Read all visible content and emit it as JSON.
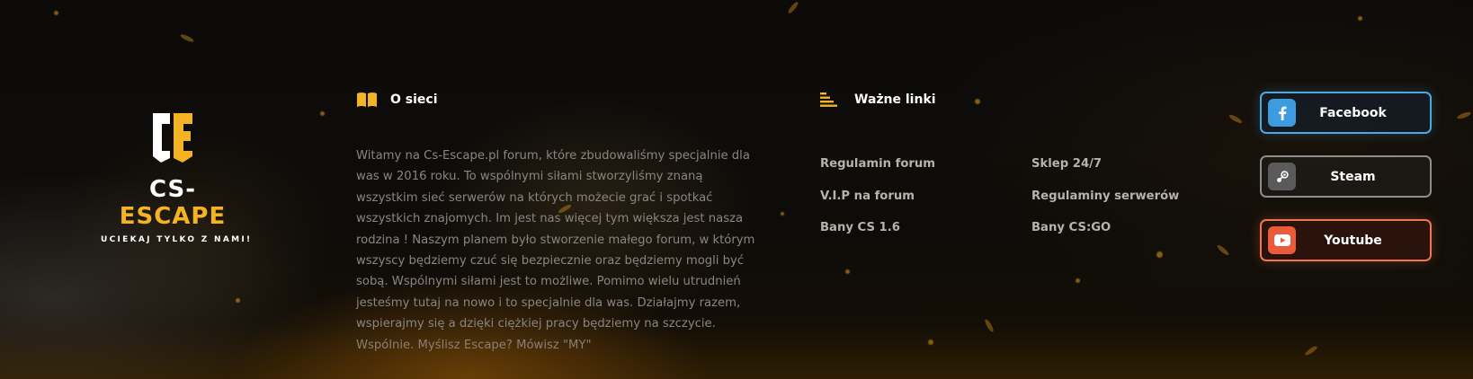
{
  "brand": {
    "logo_letters": "CE",
    "name_part1": "CS-",
    "name_part2": "ESCAPE",
    "tagline": "UCIEKAJ TYLKO Z NAMI!"
  },
  "about": {
    "icon": "book-icon",
    "title": "O sieci",
    "text": "Witamy na Cs-Escape.pl forum, które zbudowaliśmy specjalnie dla was w 2016 roku. To wspólnymi siłami stworzyliśmy znaną wszystkim sieć serwerów na których możecie grać i spotkać wszystkich znajomych. Im jest nas więcej tym większa jest nasza rodzina ! Naszym planem było stworzenie małego forum, w którym wszyscy będziemy czuć się bezpiecznie oraz będziemy mogli być sobą. Wspólnymi siłami jest to możliwe. Pomimo wielu utrudnień jesteśmy tutaj na nowo i to specjalnie dla was. Działajmy razem, wspierajmy się a dzięki ciężkiej pracy będziemy na szczycie. Wspólnie. Myślisz Escape? Mówisz \"MY\""
  },
  "links": {
    "icon": "list-icon",
    "title": "Ważne linki",
    "items": [
      {
        "label": "Regulamin forum"
      },
      {
        "label": "Sklep 24/7"
      },
      {
        "label": "V.I.P na forum"
      },
      {
        "label": "Regulaminy serwerów"
      },
      {
        "label": "Bany CS 1.6"
      },
      {
        "label": "Bany CS:GO"
      }
    ]
  },
  "social": {
    "buttons": [
      {
        "label": "Facebook",
        "icon": "facebook-icon",
        "color": "#4ea8e6"
      },
      {
        "label": "Steam",
        "icon": "steam-icon",
        "color": "#8d8d8d"
      },
      {
        "label": "Youtube",
        "icon": "youtube-icon",
        "color": "#ef7553"
      }
    ]
  },
  "colors": {
    "accent": "#f4b323",
    "background": "#0b0a09",
    "text_muted": "#8a8580",
    "link": "#b7b3ac"
  }
}
